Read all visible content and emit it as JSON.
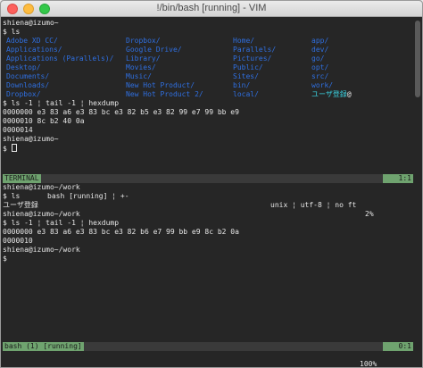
{
  "window": {
    "title": "!/bin/bash [running] - VIM"
  },
  "colors": {
    "background": "#262626",
    "link_blue": "#2f6fe0",
    "cyan": "#3ad1e0",
    "badge_green": "#6fa36f",
    "statusbar": "#3a3a3a"
  },
  "top_terminal": {
    "prompt1": "shiena@izumo~",
    "cmd1": "$ ls",
    "ls_col1": [
      "Adobe XD CC/",
      "Applications/",
      "Applications (Parallels)/",
      "Desktop/",
      "Documents/",
      "Downloads/",
      "Dropbox/"
    ],
    "ls_col2": [
      "Dropbox/",
      "Google Drive/",
      "Library/",
      "Movies/",
      "Music/",
      "New Hot Product/",
      "New Hot Product 2/"
    ],
    "ls_col3": [
      "Home/",
      "Parallels/",
      "Pictures/",
      "Public/",
      "Sites/",
      "bin/",
      "local/"
    ],
    "ls_col4": [
      "app/",
      "dev/",
      "go/",
      "opt/",
      "src/",
      "work/",
      "ユーザ登録"
    ],
    "ls_col4_suffix": "@",
    "cmd2": "$ ls -1 ¦ tail -1 ¦ hexdump",
    "hex1": "0000000 e3 83 a6 e3 83 bc e3 82 b5 e3 82 99 e7 99 bb e9",
    "hex2": "0000010 8c b2 40 0a",
    "hex3": "0000014",
    "prompt2": "shiena@izumo~",
    "cmd3": "$ "
  },
  "status_top": {
    "mode": "TERMINAL",
    "left": "bash [running] ¦ +-",
    "right": "unix ¦ utf-8 ¦ no ft",
    "percent": "2%",
    "pos": "1:1"
  },
  "bottom_terminal": {
    "prompt1": "shiena@izumo~/work",
    "cmd1": "$ ls",
    "out1": "ユーザ登録",
    "prompt2": "shiena@izumo~/work",
    "cmd2": "$ ls -1 ¦ tail -1 ¦ hexdump",
    "hex1": "0000000 e3 83 a6 e3 83 bc e3 82 b6 e7 99 bb e9 8c b2 0a",
    "hex2": "0000010",
    "prompt3": "shiena@izumo~/work",
    "cmd3": "$"
  },
  "status_bottom": {
    "left": "bash (1) [running]",
    "percent": "100%",
    "pos": "0:1"
  }
}
